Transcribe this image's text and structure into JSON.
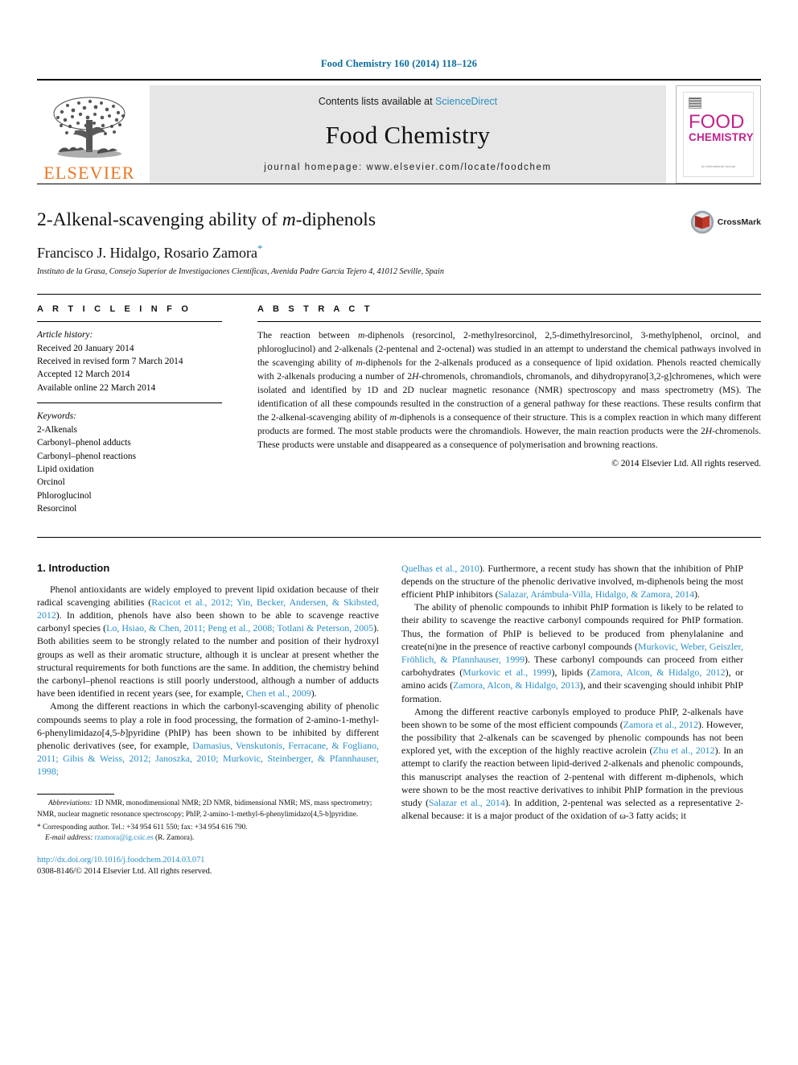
{
  "running_head": "Food Chemistry 160 (2014) 118–126",
  "masthead": {
    "contents_prefix": "Contents lists available at ",
    "sciencedirect": "ScienceDirect",
    "journal_name": "Food Chemistry",
    "homepage": "journal homepage: www.elsevier.com/locate/foodchem",
    "publisher_wordmark": "ELSEVIER",
    "cover": {
      "line1": "FOOD",
      "line2": "CHEMISTRY",
      "footer": "An International Journal"
    },
    "colors": {
      "elsevier_orange": "#E87722",
      "link_blue": "#2a8fc4",
      "cover_magenta": "#c0248f",
      "masthead_gray": "#e6e6e6"
    }
  },
  "title_block": {
    "title_part1": "2-Alkenal-scavenging ability of ",
    "title_italic": "m",
    "title_part2": "-diphenols",
    "authors": "Francisco J. Hidalgo, Rosario Zamora",
    "corresponding_marker": "*",
    "affiliation": "Instituto de la Grasa, Consejo Superior de Investigaciones Científicas, Avenida Padre García Tejero 4, 41012 Seville, Spain",
    "crossmark_label": "CrossMark"
  },
  "article_info": {
    "heading": "A R T I C L E    I N F O",
    "history_label": "Article history:",
    "history": [
      "Received 20 January 2014",
      "Received in revised form 7 March 2014",
      "Accepted 12 March 2014",
      "Available online 22 March 2014"
    ],
    "keywords_label": "Keywords:",
    "keywords": [
      "2-Alkenals",
      "Carbonyl–phenol adducts",
      "Carbonyl–phenol reactions",
      "Lipid oxidation",
      "Orcinol",
      "Phloroglucinol",
      "Resorcinol"
    ]
  },
  "abstract": {
    "heading": "A B S T R A C T",
    "text_p1": "The reaction between ",
    "text_i1": "m",
    "text_p2": "-diphenols (resorcinol, 2-methylresorcinol, 2,5-dimethylresorcinol, 3-methylphenol, orcinol, and phloroglucinol) and 2-alkenals (2-pentenal and 2-octenal) was studied in an attempt to understand the chemical pathways involved in the scavenging ability of ",
    "text_i2": "m",
    "text_p3": "-diphenols for the 2-alkenals produced as a consequence of lipid oxidation. Phenols reacted chemically with 2-alkenals producing a number of 2",
    "text_i3": "H",
    "text_p4": "-chromenols, chromandiols, chromanols, and dihydropyrano[3,2-g]chromenes, which were isolated and identified by 1D and 2D nuclear magnetic resonance (NMR) spectroscopy and mass spectrometry (MS). The identification of all these compounds resulted in the construction of a general pathway for these reactions. These results confirm that the 2-alkenal-scavenging ability of ",
    "text_i4": "m",
    "text_p5": "-diphenols is a consequence of their structure. This is a complex reaction in which many different products are formed. The most stable products were the chromandiols. However, the main reaction products were the 2",
    "text_i5": "H",
    "text_p6": "-chromenols. These products were unstable and disappeared as a consequence of polymerisation and browning reactions.",
    "copyright": "© 2014 Elsevier Ltd. All rights reserved."
  },
  "body": {
    "section_heading": "1. Introduction",
    "left_col": {
      "p1_a": "Phenol antioxidants are widely employed to prevent lipid oxidation because of their radical scavenging abilities (",
      "p1_cite1": "Racicot et al., 2012; Yin, Becker, Andersen, & Skibsted, 2012",
      "p1_b": "). In addition, phenols have also been shown to be able to scavenge reactive carbonyl species (",
      "p1_cite2": "Lo, Hsiao, & Chen, 2011; Peng et al., 2008; Totlani & Peterson, 2005",
      "p1_c": "). Both abilities seem to be strongly related to the number and position of their hydroxyl groups as well as their aromatic structure, although it is unclear at present whether the structural requirements for both functions are the same. In addition, the chemistry behind the carbonyl–phenol reactions is still poorly understood, although a number of adducts have been identified in recent years (see, for example, ",
      "p1_cite3": "Chen et al., 2009",
      "p1_d": ").",
      "p2_a": "Among the different reactions in which the carbonyl-scavenging ability of phenolic compounds seems to play a role in food processing, the formation of 2-amino-1-methyl-6-phenylimidazo[4,5-",
      "p2_i1": "b",
      "p2_b": "]pyridine (PhIP) has been shown to be inhibited by different phenolic derivatives (see, for example, ",
      "p2_cite1": "Damasius, Venskutonis, Ferracane, & Fogliano, 2011; Gibis & Weiss, 2012; Janoszka, 2010; Murkovic, Steinberger, & Pfannhauser, 1998;"
    },
    "right_col": {
      "p2_cite_cont": "Quelhas et al., 2010",
      "p2_cont": "). Furthermore, a recent study has shown that the inhibition of PhIP depends on the structure of the phenolic derivative involved, m-diphenols being the most efficient PhIP inhibitors (",
      "p2_cite2": "Salazar, Arámbula-Villa, Hidalgo, & Zamora, 2014",
      "p2_end": ").",
      "p3_a": "The ability of phenolic compounds to inhibit PhIP formation is likely to be related to their ability to scavenge the reactive carbonyl compounds required for PhIP formation. Thus, the formation of PhIP is believed to be produced from phenylalanine and create(ni)ne in the presence of reactive carbonyl compounds (",
      "p3_cite1": "Murkovic, Weber, Geiszler, Fröhlich, & Pfannhauser, 1999",
      "p3_b": "). These carbonyl compounds can proceed from either carbohydrates (",
      "p3_cite2": "Murkovic et al., 1999",
      "p3_c": "), lipids (",
      "p3_cite3": "Zamora, Alcon, & Hidalgo, 2012",
      "p3_d": "), or amino acids (",
      "p3_cite4": "Zamora, Alcon, & Hidalgo, 2013",
      "p3_e": "), and their scavenging should inhibit PhIP formation.",
      "p4_a": "Among the different reactive carbonyls employed to produce PhIP, 2-alkenals have been shown to be some of the most efficient compounds (",
      "p4_cite1": "Zamora et al., 2012",
      "p4_b": "). However, the possibility that 2-alkenals can be scavenged by phenolic compounds has not been explored yet, with the exception of the highly reactive acrolein (",
      "p4_cite2": "Zhu et al., 2012",
      "p4_c": "). In an attempt to clarify the reaction between lipid-derived 2-alkenals and phenolic compounds, this manuscript analyses the reaction of 2-pentenal with different m-diphenols, which were shown to be the most reactive derivatives to inhibit PhIP formation in the previous study (",
      "p4_cite3": "Salazar et al., 2014",
      "p4_d": "). In addition, 2-pentenal was selected as a representative 2-alkenal because: it is a major product of the oxidation of ω-3 fatty acids; it"
    }
  },
  "footnotes": {
    "abbrev_label": "Abbreviations:",
    "abbrev_text": " 1D NMR, monodimensional NMR; 2D NMR, bidimensional NMR; MS, mass spectrometry; NMR, nuclear magnetic resonance spectroscopy; PhIP, 2-amino-1-methyl-6-phenylimidazo[4,5-b]pyridine.",
    "corresponding": "* Corresponding author. Tel.: +34 954 611 550; fax: +34 954 616 790.",
    "email_label": "E-mail address:",
    "email": "rzamora@ig.csic.es",
    "email_suffix": " (R. Zamora).",
    "doi": "http://dx.doi.org/10.1016/j.foodchem.2014.03.071",
    "issn": "0308-8146/© 2014 Elsevier Ltd. All rights reserved."
  }
}
